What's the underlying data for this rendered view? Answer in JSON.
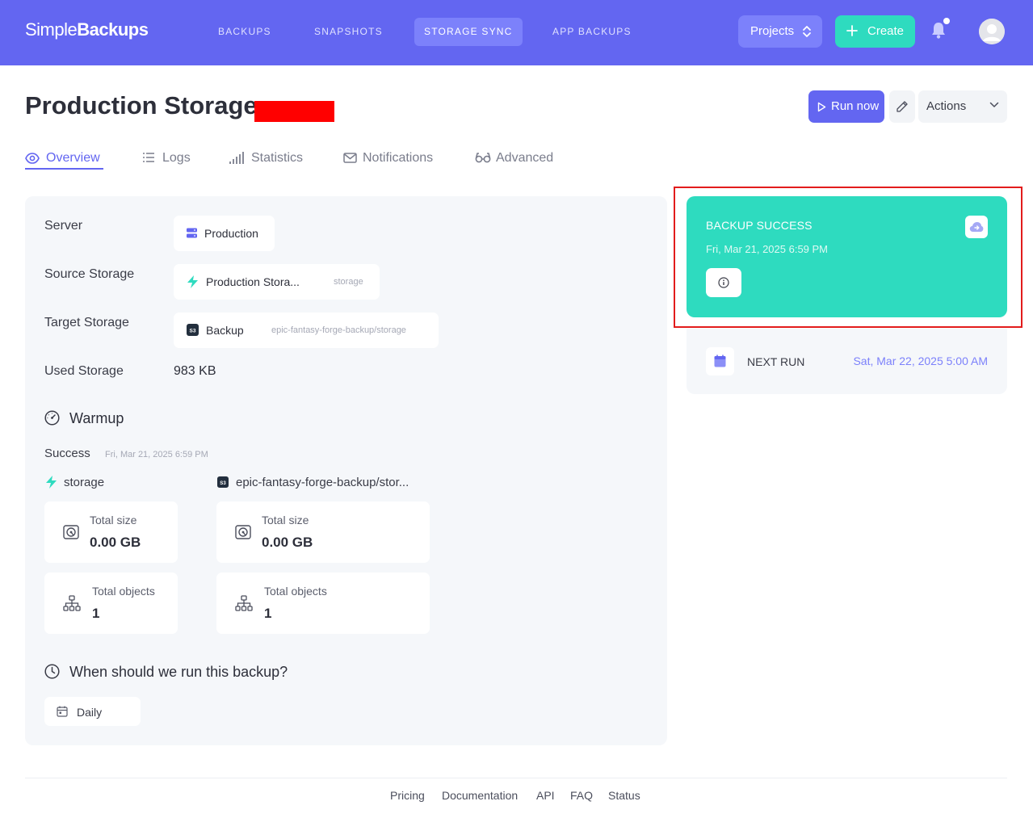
{
  "brand": {
    "part1": "Simple",
    "part2": "Backups"
  },
  "nav": {
    "items": [
      {
        "label": "BACKUPS"
      },
      {
        "label": "SNAPSHOTS"
      },
      {
        "label": "STORAGE SYNC"
      },
      {
        "label": "APP BACKUPS"
      }
    ],
    "active": "STORAGE SYNC",
    "projects_label": "Projects",
    "create_label": "Create"
  },
  "page": {
    "title": "Production Storage",
    "run_now": "Run now",
    "actions": "Actions"
  },
  "tabs": [
    {
      "label": "Overview",
      "icon": "eye-icon"
    },
    {
      "label": "Logs",
      "icon": "list-icon"
    },
    {
      "label": "Statistics",
      "icon": "bars-icon"
    },
    {
      "label": "Notifications",
      "icon": "envelope-icon"
    },
    {
      "label": "Advanced",
      "icon": "glasses-icon"
    }
  ],
  "details": {
    "server_label": "Server",
    "server_value": "Production",
    "source_label": "Source Storage",
    "source_value": "Production Stora...",
    "source_sub": "storage",
    "target_label": "Target Storage",
    "target_value": "Backup",
    "target_sub": "epic-fantasy-forge-backup/storage",
    "used_label": "Used Storage",
    "used_value": "983 KB"
  },
  "warmup": {
    "title": "Warmup",
    "status": "Success",
    "date": "Fri, Mar 21, 2025 6:59 PM",
    "source": {
      "name": "storage",
      "size_label": "Total size",
      "size_value": "0.00 GB",
      "objects_label": "Total objects",
      "objects_value": "1"
    },
    "target": {
      "name": "epic-fantasy-forge-backup/stor...",
      "size_label": "Total size",
      "size_value": "0.00 GB",
      "objects_label": "Total objects",
      "objects_value": "1"
    }
  },
  "schedule": {
    "title": "When should we run this backup?",
    "frequency": "Daily"
  },
  "status_card": {
    "title": "BACKUP SUCCESS",
    "date": "Fri, Mar 21, 2025 6:59 PM",
    "color": "#2edbbf"
  },
  "next_run": {
    "label": "NEXT RUN",
    "date": "Sat, Mar 22, 2025 5:00 AM"
  },
  "footer": {
    "links": [
      "Pricing",
      "Documentation",
      "API",
      "FAQ",
      "Status"
    ]
  },
  "colors": {
    "primary": "#6366f1",
    "accent": "#2edbbf"
  }
}
